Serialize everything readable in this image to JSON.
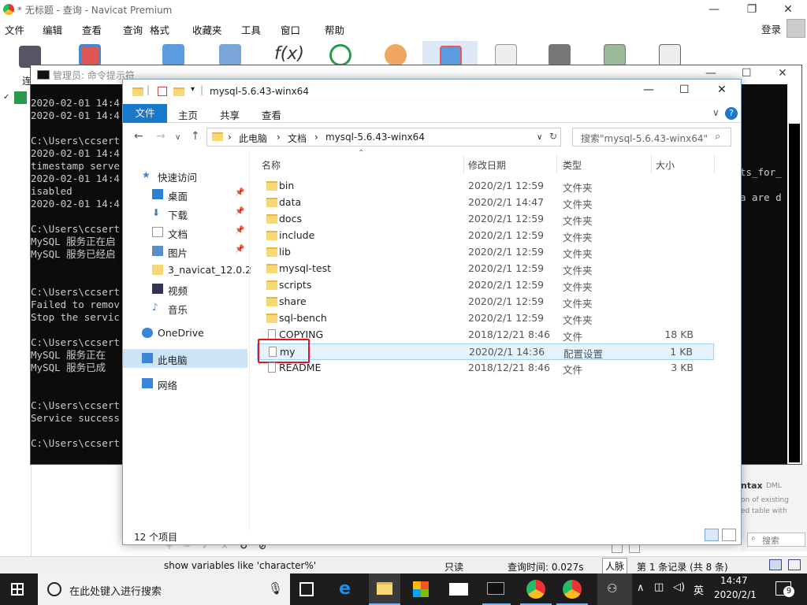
{
  "navicat": {
    "title": "* 无标题 - 查询 - Navicat Premium",
    "menu": [
      "文件",
      "编辑",
      "查看",
      "查询",
      "格式",
      "收藏夹",
      "工具",
      "窗口",
      "帮助"
    ],
    "login": "登录",
    "left_label": "连",
    "right_hints": [
      "ntax",
      "DML",
      "on of existing",
      "ed table with"
    ],
    "search_label": "搜索",
    "status": {
      "sql": "show variables like 'character%'",
      "readonly": "只读",
      "query_time": "查询时间: 0.027s",
      "tooltip": "人脉",
      "records": "第 1 条记录 (共 8 条)"
    }
  },
  "cmd": {
    "title": "管理员: 命令提示符",
    "lines": [
      "2020-02-01 14:4",
      "2020-02-01 14:4",
      "",
      "C:\\Users\\ccsert",
      "2020-02-01 14:4",
      "timestamp serve",
      "2020-02-01 14:4",
      "isabled",
      "2020-02-01 14:4",
      "",
      "C:\\Users\\ccsert",
      "MySQL 服务正在启",
      "MySQL 服务已经启",
      "",
      "",
      "C:\\Users\\ccsert",
      "Failed to remov",
      "Stop the servic",
      "",
      "C:\\Users\\ccsert",
      "MySQL 服务正在",
      "MySQL 服务已成",
      "",
      "",
      "C:\\Users\\ccsert",
      "Service success",
      "",
      "C:\\Users\\ccsert"
    ],
    "right_lines": [
      "ts_for_",
      "a are d"
    ]
  },
  "explorer": {
    "title": "mysql-5.6.43-winx64",
    "ribbon": {
      "file": "文件",
      "home": "主页",
      "share": "共享",
      "view": "查看"
    },
    "breadcrumb": [
      "此电脑",
      "文档",
      "mysql-5.6.43-winx64"
    ],
    "search_placeholder": "搜索\"mysql-5.6.43-winx64\"",
    "nav": [
      {
        "label": "快速访问"
      },
      {
        "label": "桌面"
      },
      {
        "label": "下载"
      },
      {
        "label": "文档"
      },
      {
        "label": "图片"
      },
      {
        "label": "3_navicat_12.0.2"
      },
      {
        "label": "视频"
      },
      {
        "label": "音乐"
      },
      {
        "label": "OneDrive"
      },
      {
        "label": "此电脑"
      },
      {
        "label": "网络"
      }
    ],
    "columns": {
      "name": "名称",
      "date": "修改日期",
      "type": "类型",
      "size": "大小"
    },
    "files": [
      {
        "name": "bin",
        "date": "2020/2/1 12:59",
        "type": "文件夹",
        "size": "",
        "icon": "folder-icon"
      },
      {
        "name": "data",
        "date": "2020/2/1 14:47",
        "type": "文件夹",
        "size": "",
        "icon": "folder-icon"
      },
      {
        "name": "docs",
        "date": "2020/2/1 12:59",
        "type": "文件夹",
        "size": "",
        "icon": "folder-icon"
      },
      {
        "name": "include",
        "date": "2020/2/1 12:59",
        "type": "文件夹",
        "size": "",
        "icon": "folder-icon"
      },
      {
        "name": "lib",
        "date": "2020/2/1 12:59",
        "type": "文件夹",
        "size": "",
        "icon": "folder-icon"
      },
      {
        "name": "mysql-test",
        "date": "2020/2/1 12:59",
        "type": "文件夹",
        "size": "",
        "icon": "folder-icon"
      },
      {
        "name": "scripts",
        "date": "2020/2/1 12:59",
        "type": "文件夹",
        "size": "",
        "icon": "folder-icon"
      },
      {
        "name": "share",
        "date": "2020/2/1 12:59",
        "type": "文件夹",
        "size": "",
        "icon": "folder-icon"
      },
      {
        "name": "sql-bench",
        "date": "2020/2/1 12:59",
        "type": "文件夹",
        "size": "",
        "icon": "folder-icon"
      },
      {
        "name": "COPYING",
        "date": "2018/12/21 8:46",
        "type": "文件",
        "size": "18 KB",
        "icon": "file-icon"
      },
      {
        "name": "my",
        "date": "2020/2/1 14:36",
        "type": "配置设置",
        "size": "1 KB",
        "icon": "settings-file-icon"
      },
      {
        "name": "README",
        "date": "2018/12/21 8:46",
        "type": "文件",
        "size": "3 KB",
        "icon": "file-icon"
      }
    ],
    "item_count": "12 个项目"
  },
  "taskbar": {
    "search_placeholder": "在此处键入进行搜索",
    "ime": "英",
    "time": "14:47",
    "date": "2020/2/1",
    "notification_count": "9"
  },
  "colors": {
    "accent": "#1979ca",
    "highlight": "#e81123"
  }
}
